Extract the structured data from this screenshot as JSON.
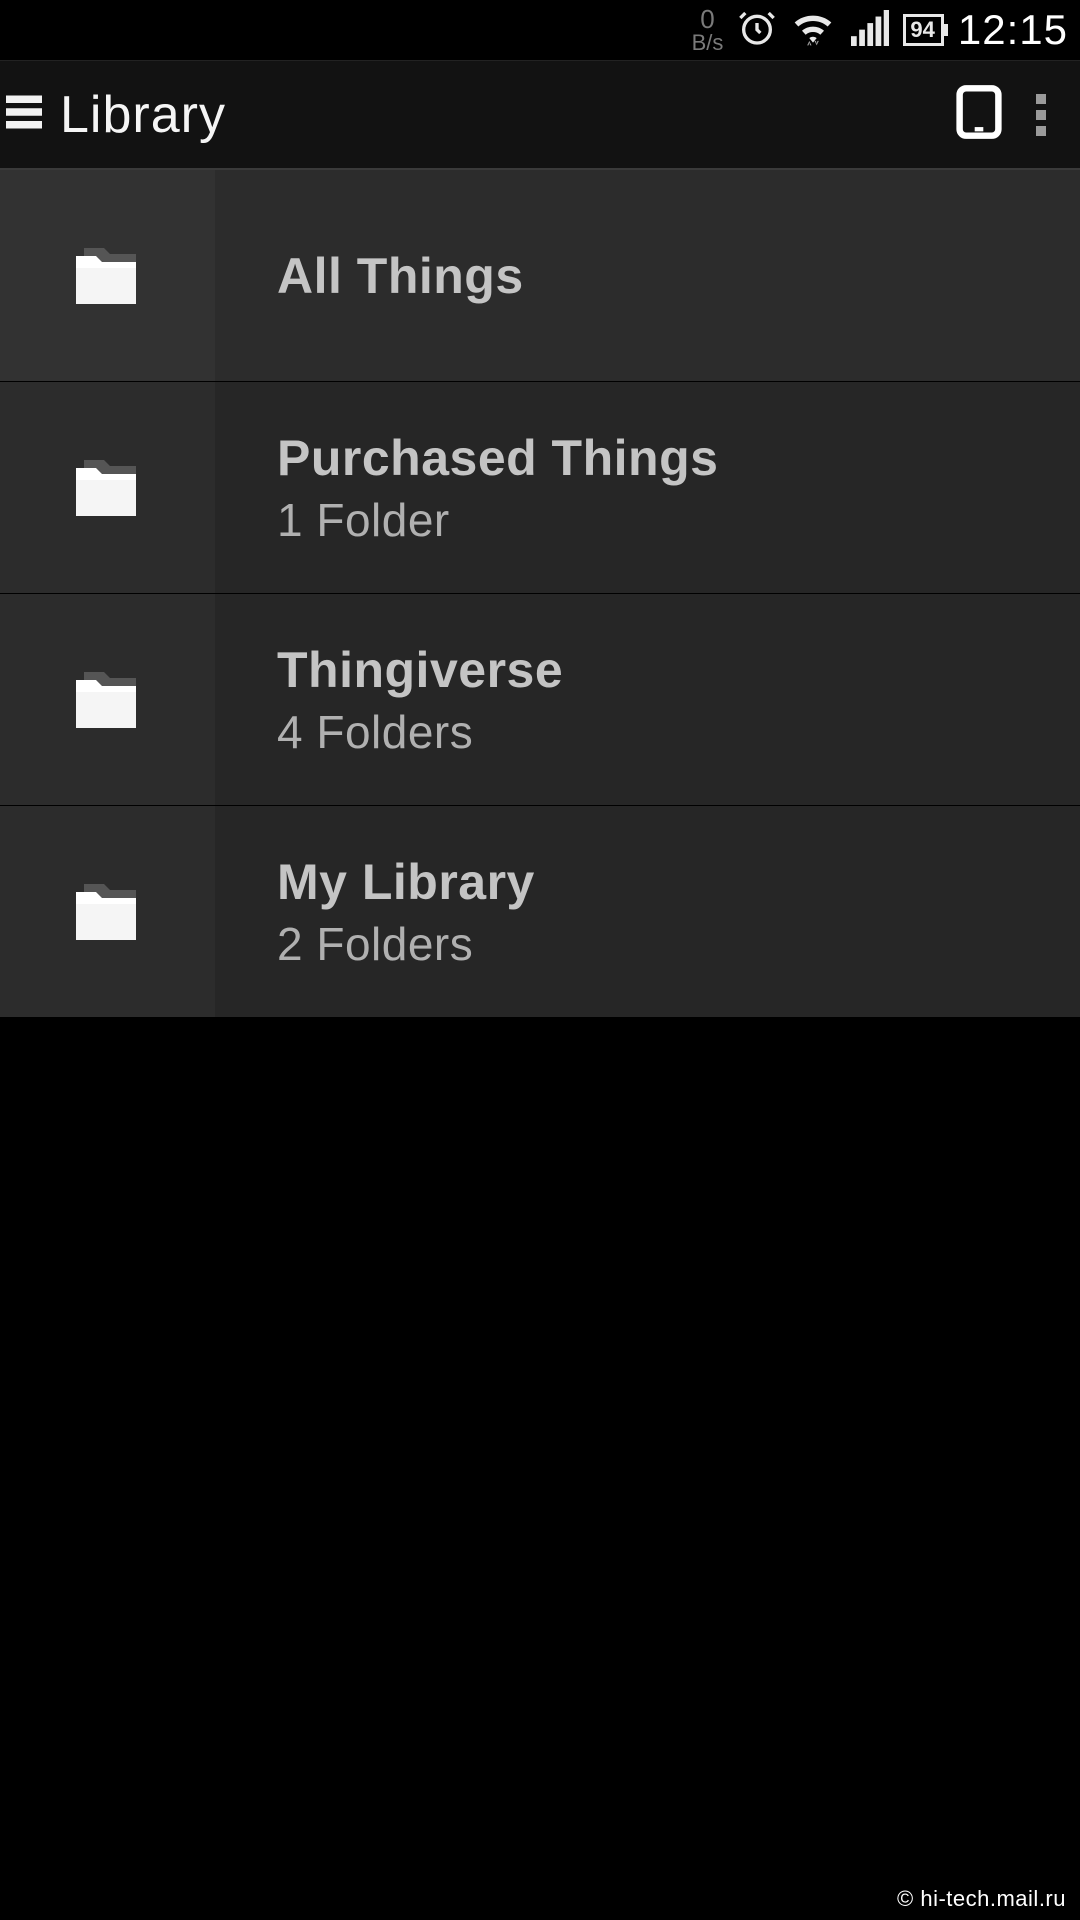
{
  "status": {
    "net_value": "0",
    "net_unit": "B/s",
    "battery": "94",
    "time": "12:15"
  },
  "header": {
    "title": "Library"
  },
  "items": [
    {
      "title": "All Things",
      "sub": ""
    },
    {
      "title": "Purchased Things",
      "sub": "1 Folder"
    },
    {
      "title": "Thingiverse",
      "sub": "4 Folders"
    },
    {
      "title": "My Library",
      "sub": "2 Folders"
    }
  ],
  "watermark": "© hi-tech.mail.ru"
}
